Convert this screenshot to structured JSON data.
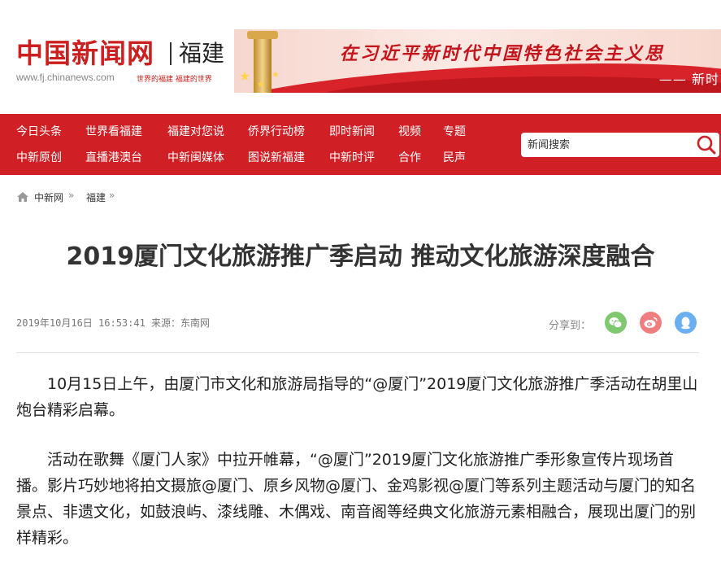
{
  "header": {
    "logo_text": "中国新闻网",
    "region": "福建",
    "site_url": "www.fj.chinanews.com",
    "slogan": "世界的福建  福建的世界",
    "banner_text": "在习近平新时代中国特色社会主义思",
    "banner_sub": "—— 新时"
  },
  "nav": {
    "row1": [
      "今日头条",
      "世界看福建",
      "福建对您说",
      "侨界行动榜",
      "即时新闻",
      "视频",
      "专题"
    ],
    "row2": [
      "中新原创",
      "直播港澳台",
      "中新闽媒体",
      "图说新福建",
      "中新时评",
      "合作",
      "民声"
    ],
    "search_placeholder": "新闻搜索"
  },
  "breadcrumb": {
    "items": [
      "中新网",
      "福建"
    ],
    "separator": "»"
  },
  "article": {
    "title": "2019厦门文化旅游推广季启动 推动文化旅游深度融合",
    "meta": "2019年10月16日 16:53:41 来源：东南网",
    "share_label": "分享到：",
    "paragraphs": [
      "10月15日上午，由厦门市文化和旅游局指导的“@厦门”2019厦门文化旅游推广季活动在胡里山炮台精彩启幕。",
      "活动在歌舞《厦门人家》中拉开帷幕，“@厦门”2019厦门文化旅游推广季形象宣传片现场首播。影片巧妙地将拍文摄旅@厦门、原乡风物@厦门、金鸡影视@厦门等系列主题活动与厦门的知名景点、非遗文化，如鼓浪屿、漆线雕、木偶戏、南音阁等经典文化旅游元素相融合，展现出厦门的别样精彩。"
    ]
  },
  "icons": {
    "search": "search-icon",
    "home": "home-icon",
    "wechat": "wechat-icon",
    "weibo": "weibo-icon",
    "qq": "qq-icon"
  },
  "colors": {
    "brand_red": "#d11f26",
    "wechat": "#7fc870",
    "weibo": "#f07e7e",
    "qq": "#6aaff0"
  }
}
